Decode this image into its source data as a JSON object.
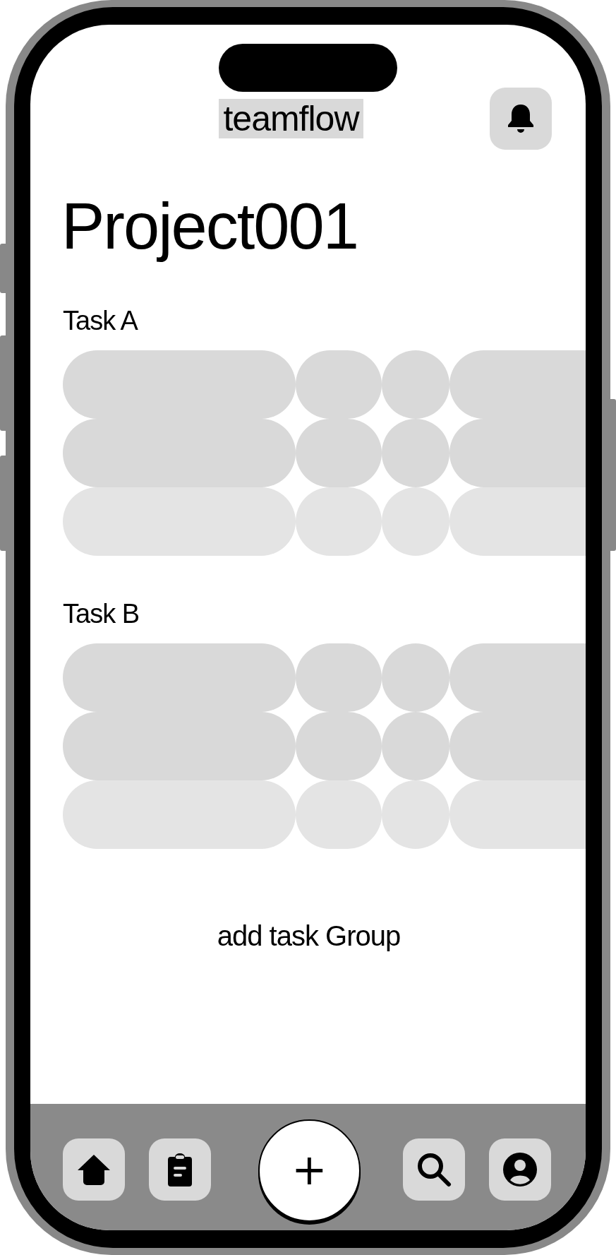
{
  "header": {
    "logo": "teamflow"
  },
  "project": {
    "title": "Project001"
  },
  "task_groups": [
    {
      "title": "Task A",
      "rows": [
        {
          "kind": "filled"
        },
        {
          "kind": "filled"
        },
        {
          "kind": "faded"
        }
      ]
    },
    {
      "title": "Task B",
      "rows": [
        {
          "kind": "filled"
        },
        {
          "kind": "filled"
        },
        {
          "kind": "faded"
        }
      ]
    }
  ],
  "add_group": {
    "label": "add task Group"
  },
  "bottom_nav": {
    "add_button": "+"
  }
}
